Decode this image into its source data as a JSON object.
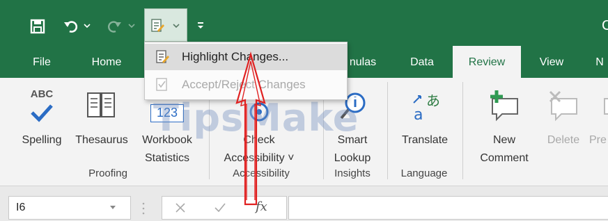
{
  "colors": {
    "excel_green": "#217346",
    "ribbon_bg": "#f3f3f3",
    "arrow_red": "#e02020"
  },
  "quick_access": {
    "icons": [
      "save-icon",
      "undo-icon",
      "redo-icon",
      "track-changes-icon",
      "customize-qat-icon"
    ]
  },
  "title_partial": "C",
  "tabs": [
    {
      "label": "File"
    },
    {
      "label": "Home"
    },
    {
      "label": "nulas"
    },
    {
      "label": "Data"
    },
    {
      "label": "Review",
      "active": true
    },
    {
      "label": "View"
    },
    {
      "label": "N"
    }
  ],
  "dropdown": {
    "items": [
      {
        "label": "Highlight Changes...",
        "enabled": true,
        "hover": true
      },
      {
        "label": "Accept/Reject Changes",
        "enabled": false
      }
    ]
  },
  "ribbon": {
    "proofing": {
      "group_label": "Proofing",
      "spelling_label": "Spelling",
      "spelling_icon_text": "ABC",
      "thesaurus_label": "Thesaurus",
      "workbook_stats_line1": "Workbook",
      "workbook_stats_line2": "Statistics",
      "workbook_stats_icon_text": "123"
    },
    "accessibility": {
      "group_label": "Accessibility",
      "check_line1": "Check",
      "check_line2": "Accessibility ˅"
    },
    "insights": {
      "group_label": "Insights",
      "smart_line1": "Smart",
      "smart_line2": "Lookup"
    },
    "language": {
      "group_label": "Language",
      "translate_label": "Translate"
    },
    "comments": {
      "new_line1": "New",
      "new_line2": "Comment",
      "delete_label": "Delete",
      "previous_label": "Pre"
    }
  },
  "formula_bar": {
    "name_box": "I6",
    "fx_label": "fx"
  },
  "watermark": "TipsMake"
}
